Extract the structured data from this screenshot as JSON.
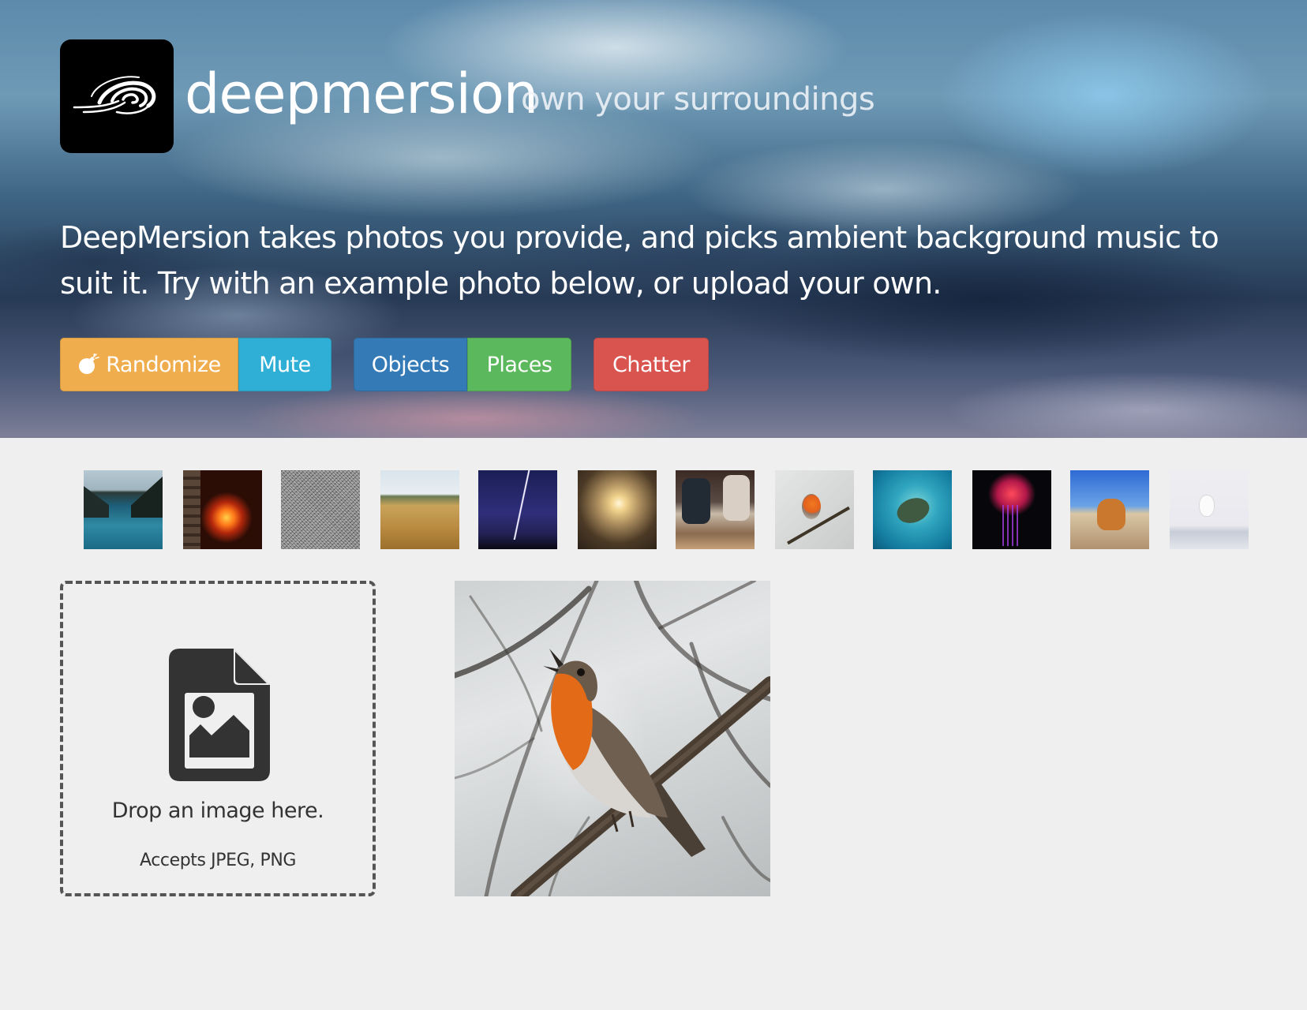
{
  "brand": {
    "name": "deepmersion",
    "tagline": "own your surroundings",
    "logo_icon": "wave-swirl-logo"
  },
  "intro": {
    "text": "DeepMersion takes photos you provide, and picks ambient background music to suit it. Try with an example photo below, or upload your own."
  },
  "toolbar": {
    "randomize_label": "Randomize",
    "mute_label": "Mute",
    "objects_label": "Objects",
    "places_label": "Places",
    "chatter_label": "Chatter",
    "colors": {
      "randomize": "#f0ad4e",
      "mute": "#2fafd6",
      "objects": "#337ab7",
      "places": "#5cb85c",
      "chatter": "#d9534f"
    }
  },
  "examples": {
    "count": 12,
    "items": [
      "river-canyon",
      "fireplace",
      "static-noise",
      "wheat-field",
      "lightning-storm",
      "sunset-grass",
      "people-cafe",
      "robin-on-branch",
      "sea-turtle",
      "jellyfish",
      "corgi-beach",
      "polar-bear-snow"
    ]
  },
  "dropzone": {
    "text": "Drop an image here.",
    "subtext": "Accepts JPEG, PNG",
    "icon": "file-image-icon"
  },
  "preview": {
    "subject": "robin-on-branch"
  }
}
